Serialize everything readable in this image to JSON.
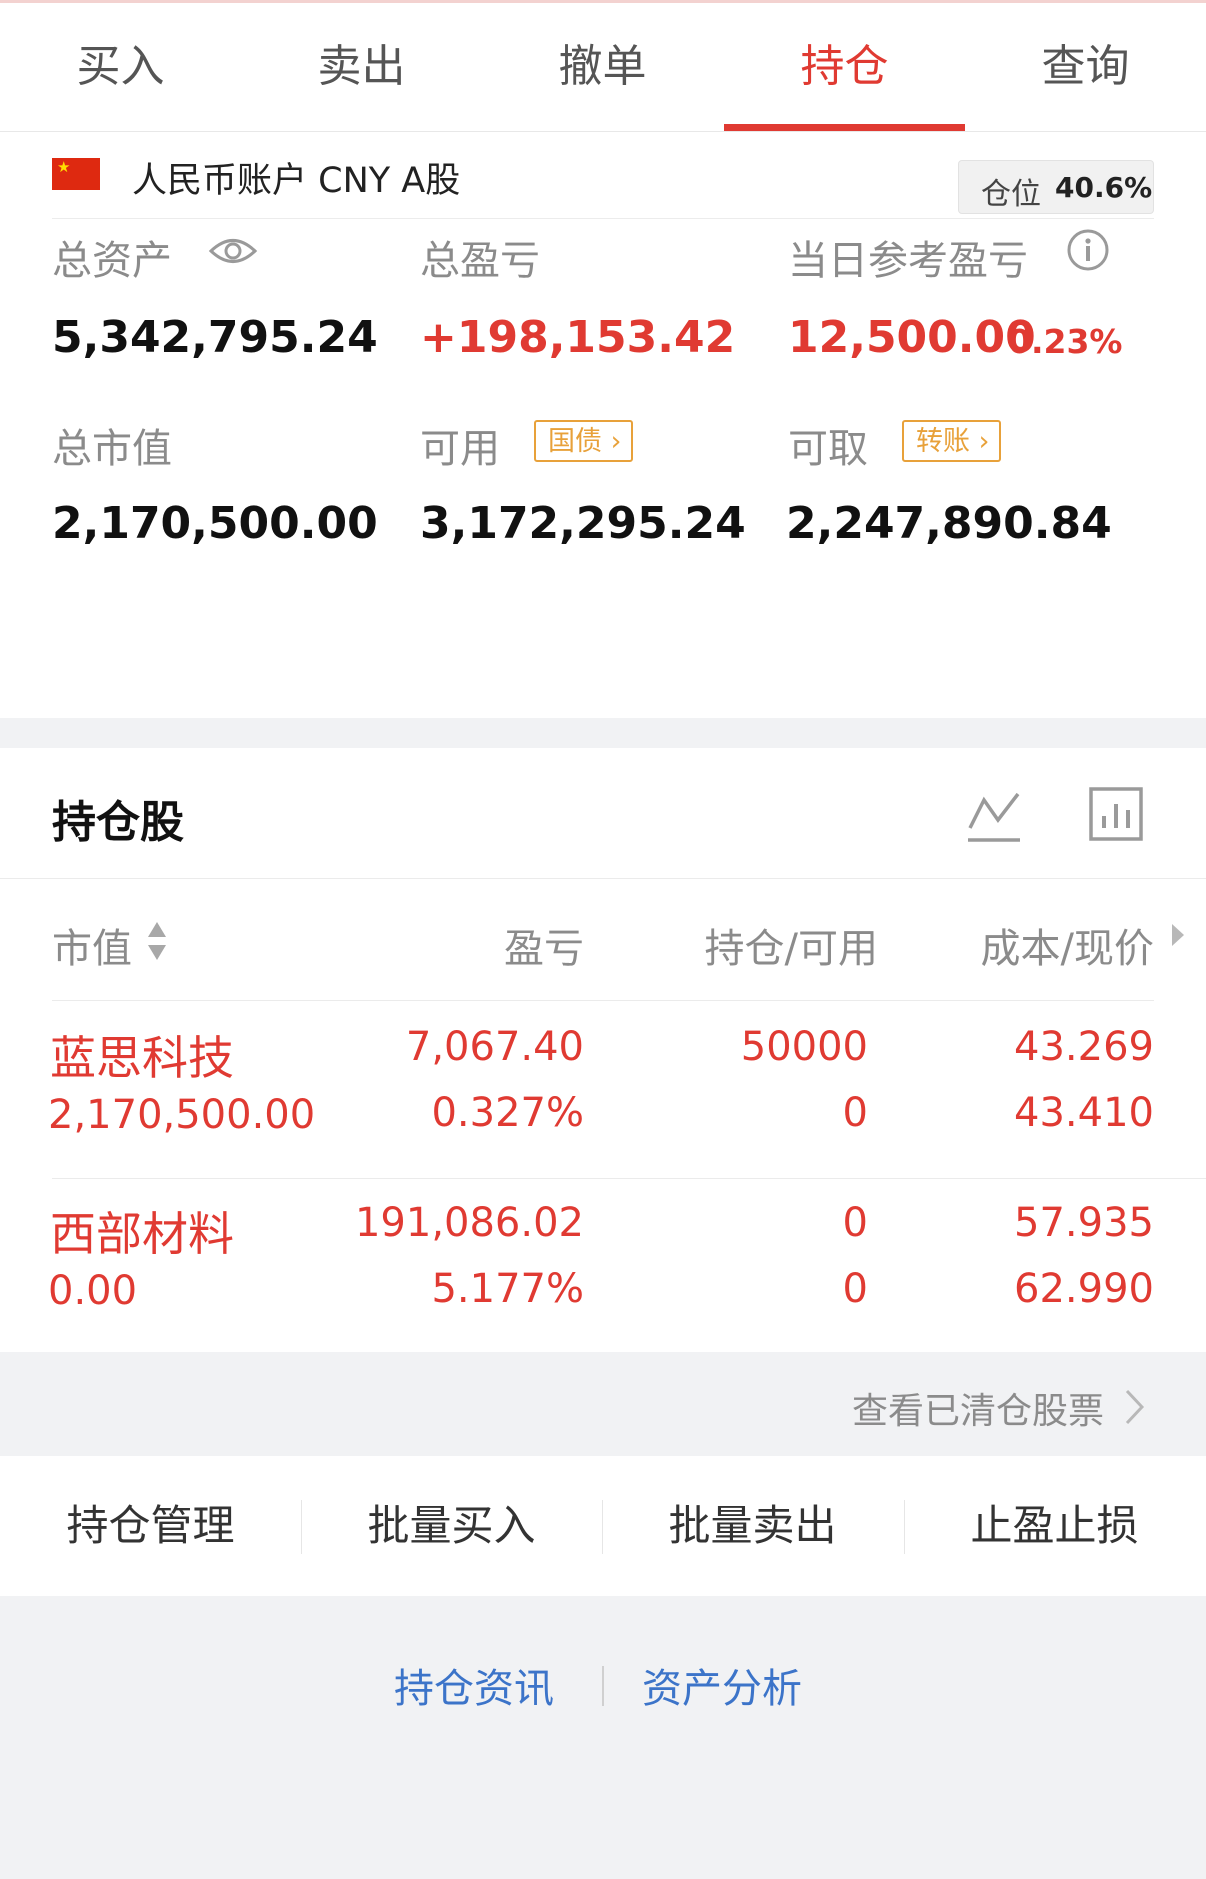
{
  "tabs": [
    {
      "label": "买入"
    },
    {
      "label": "卖出"
    },
    {
      "label": "撤单"
    },
    {
      "label": "持仓",
      "active": true
    },
    {
      "label": "查询"
    }
  ],
  "account": {
    "flag_icon": "china-flag-icon",
    "name": "人民币账户 CNY A股",
    "position_label": "仓位",
    "position_value": "40.6%"
  },
  "summary": {
    "total_assets_label": "总资产",
    "total_assets_value": "5,342,795.24",
    "total_pnl_label": "总盈亏",
    "total_pnl_value": "+198,153.42",
    "daily_pnl_label": "当日参考盈亏",
    "daily_pnl_value": "12,500.00",
    "daily_pnl_pct": "0.23%",
    "market_value_label": "总市值",
    "market_value_value": "2,170,500.00",
    "available_label": "可用",
    "available_tag": "国债",
    "available_value": "3,172,295.24",
    "withdrawable_label": "可取",
    "withdrawable_tag": "转账",
    "withdrawable_value": "2,247,890.84"
  },
  "holdings": {
    "title": "持仓股",
    "columns": {
      "market_value": "市值",
      "pnl": "盈亏",
      "position_available": "持仓/可用",
      "cost_price": "成本/现价"
    },
    "rows": [
      {
        "name": "蓝思科技",
        "market_value": "2,170,500.00",
        "pnl": "7,067.40",
        "pnl_pct": "0.327%",
        "position": "50000",
        "available": "0",
        "cost": "43.269",
        "price": "43.410"
      },
      {
        "name": "西部材料",
        "market_value": "0.00",
        "pnl": "191,086.02",
        "pnl_pct": "5.177%",
        "position": "0",
        "available": "0",
        "cost": "57.935",
        "price": "62.990"
      }
    ]
  },
  "cleared_link": "查看已清仓股票",
  "actions": [
    {
      "label": "持仓管理"
    },
    {
      "label": "批量买入"
    },
    {
      "label": "批量卖出"
    },
    {
      "label": "止盈止损"
    }
  ],
  "bottom_links": [
    {
      "label": "持仓资讯"
    },
    {
      "label": "资产分析"
    }
  ],
  "colors": {
    "accent_red": "#e03a32",
    "tag_orange": "#e8a13a",
    "link_blue": "#3c74c9"
  }
}
